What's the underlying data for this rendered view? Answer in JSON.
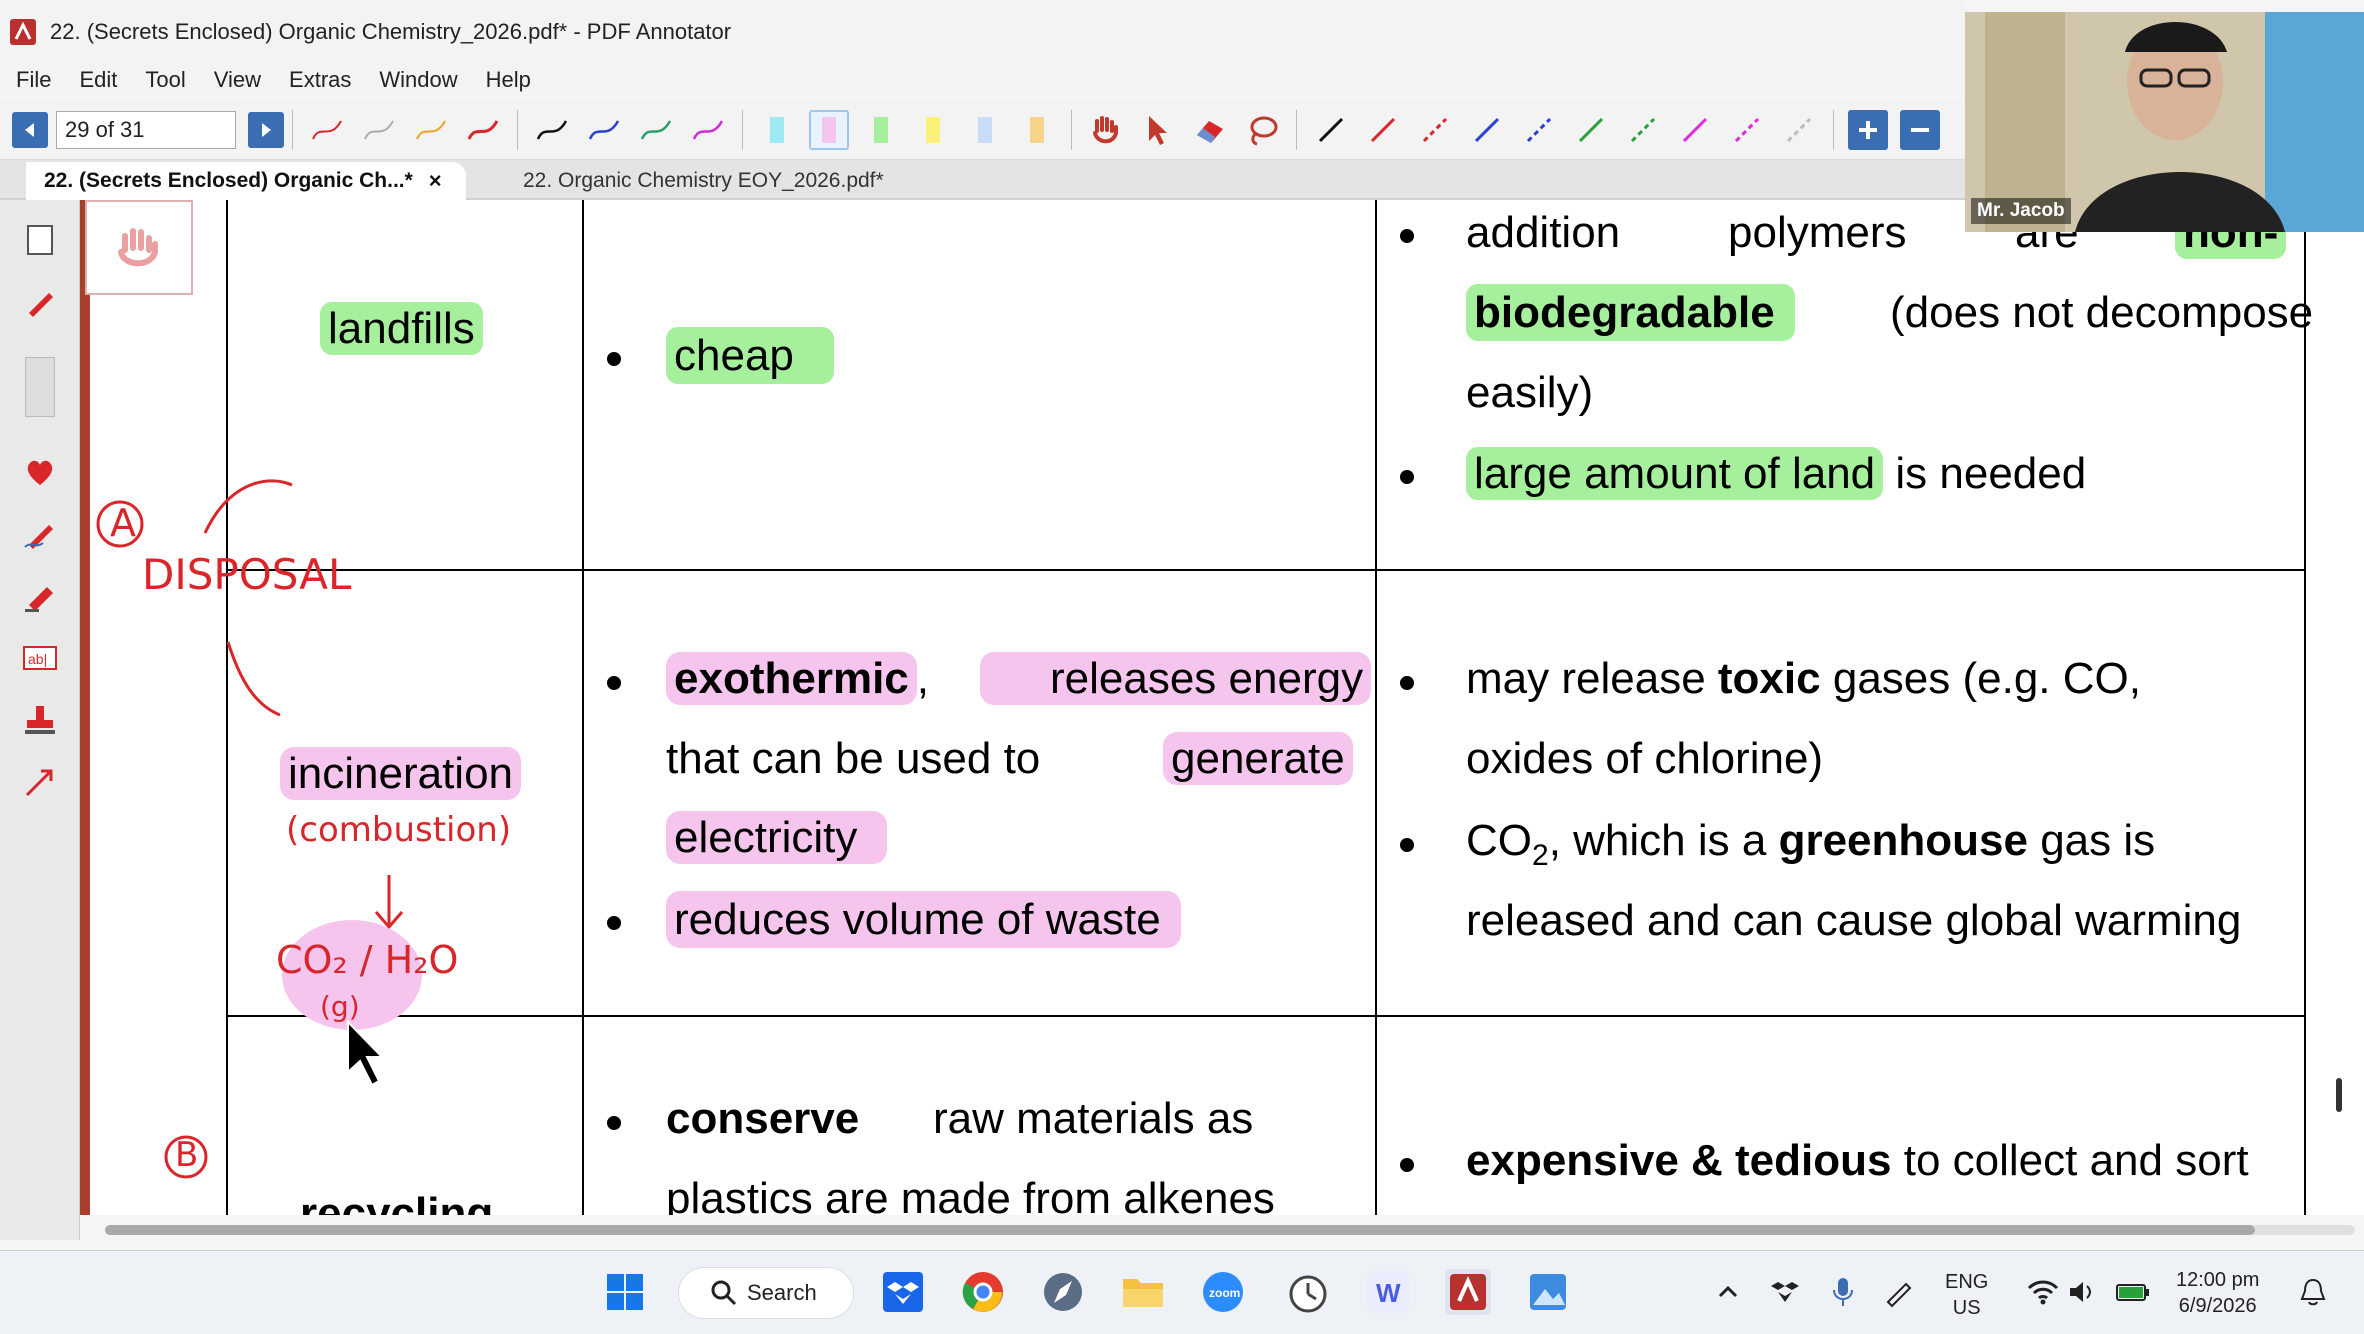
{
  "window": {
    "title": "22. (Secrets Enclosed) Organic Chemistry_2026.pdf* - PDF Annotator"
  },
  "menu": {
    "items": [
      "File",
      "Edit",
      "Tool",
      "View",
      "Extras",
      "Window",
      "Help"
    ]
  },
  "toolbar": {
    "page_indicator": "29 of 31"
  },
  "tabs": [
    {
      "label": "22. (Secrets Enclosed) Organic Ch...*",
      "active": true,
      "close": "×"
    },
    {
      "label": "22. Organic Chemistry EOY_2026.pdf*",
      "active": false
    }
  ],
  "webcam": {
    "name": "Mr. Jacob"
  },
  "document": {
    "row1": {
      "method": "landfills",
      "advantages": [
        "cheap"
      ],
      "disadvantage_1": {
        "line1_a": "addition",
        "line1_b": "polymers",
        "line1_c": "are",
        "line1_d": "non-",
        "line2_a": "biodegradable",
        "line2_b": "(does not decompose",
        "line3": "easily)"
      },
      "disadvantage_2": {
        "a": "large amount of land",
        "b": "is needed"
      }
    },
    "row2": {
      "method": "incineration",
      "adv1": {
        "l1_a": "exothermic",
        "l1_b": ",",
        "l1_c": "releases energy",
        "l2_a": "that can be used to",
        "l2_b": "generate",
        "l3": "electricity"
      },
      "adv2": "reduces volume of waste",
      "dis1": {
        "l1_a": "may release",
        "l1_b": "toxic",
        "l1_c": "gases (e.g. CO,",
        "l2": "oxides of chlorine)"
      },
      "dis2": {
        "l1_a": "CO",
        "l1_sub": "2",
        "l1_b": ", which is a",
        "l1_c": "greenhouse",
        "l1_d": "gas is",
        "l2": "released and can cause global warming"
      }
    },
    "row3": {
      "method": "recycling",
      "adv1": {
        "l1_a": "conserve",
        "l1_b": "raw materials as",
        "l2": "plastics are made from alkenes"
      },
      "dis1": {
        "a": "expensive & tedious",
        "b": "to collect and sort"
      }
    },
    "handwriting": {
      "label_a": "A",
      "disposal": "DISPOSAL",
      "combustion": "(combustion)",
      "products": "CO₂ / H₂O",
      "state": "(g)",
      "label_b": "B"
    }
  },
  "taskbar": {
    "search_label": "Search",
    "lang_top": "ENG",
    "lang_bottom": "US",
    "time": "12:00 pm",
    "date": "6/9/2026"
  },
  "colors": {
    "highlight_green": "#a6ef9c",
    "highlight_pink": "#f6c5ee",
    "ink_red": "#d8262b",
    "nav_blue": "#3b6db3"
  }
}
